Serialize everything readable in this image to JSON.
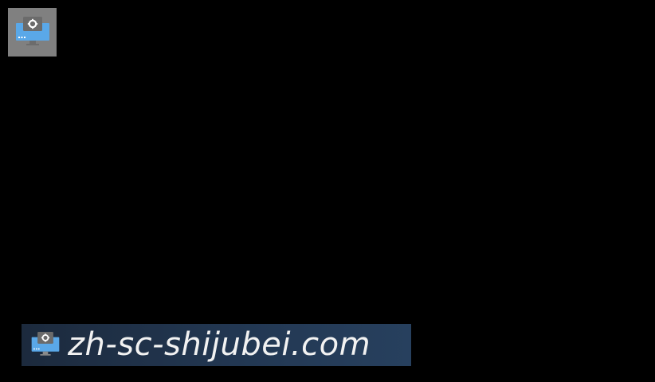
{
  "desktop": {
    "background_color": "#000000",
    "app_tile": {
      "icon": "monitor-settings-icon",
      "tile_color": "#808080",
      "screen_color": "#5aa8e8"
    }
  },
  "watermark": {
    "icon": "monitor-settings-icon",
    "text": "zh-sc-shijubei.com"
  }
}
